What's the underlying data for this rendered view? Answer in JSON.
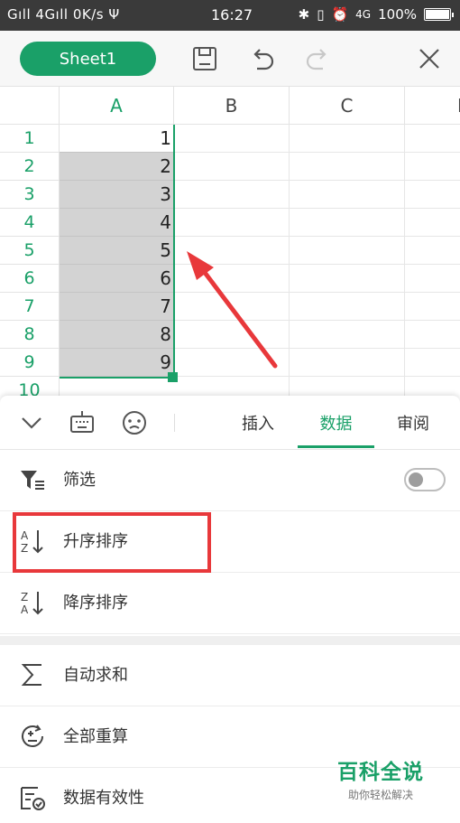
{
  "status_bar": {
    "left": "Gıll 4Gıll 0K/s Ψ",
    "time": "16:27",
    "network": "4G",
    "battery": "100%"
  },
  "toolbar": {
    "sheet_name": "Sheet1",
    "save_icon": "save-icon",
    "undo_icon": "undo-icon",
    "redo_icon": "redo-icon",
    "close_icon": "close-icon"
  },
  "grid": {
    "columns": [
      "A",
      "B",
      "C",
      "D"
    ],
    "rows": [
      "1",
      "2",
      "3",
      "4",
      "5",
      "6",
      "7",
      "8",
      "9",
      "10"
    ],
    "column_a_values": [
      "1",
      "2",
      "3",
      "4",
      "5",
      "6",
      "7",
      "8",
      "9",
      ""
    ],
    "selected_column": "A",
    "accent": "#1aa068",
    "selection_fill": "#d3d3d3"
  },
  "panel": {
    "tabs": [
      "插入",
      "数据",
      "审阅"
    ],
    "active_tab": "数据",
    "tab_icons": [
      "chevron-down-icon",
      "keyboard-icon",
      "emoji-icon"
    ],
    "items": [
      {
        "label": "筛选",
        "icon": "filter-icon",
        "toggle": "off"
      },
      {
        "label": "升序排序",
        "icon": "sort-ascending-icon",
        "highlighted": true
      },
      {
        "label": "降序排序",
        "icon": "sort-descending-icon"
      },
      {
        "label": "自动求和",
        "icon": "sum-icon"
      },
      {
        "label": "全部重算",
        "icon": "recalculate-icon"
      },
      {
        "label": "数据有效性",
        "icon": "data-validation-icon"
      }
    ]
  },
  "annotations": {
    "arrow_color": "#e8383b",
    "highlight_color": "#e8383b"
  },
  "watermark": {
    "title": "百科全说",
    "subtitle": "助你轻松解决"
  }
}
